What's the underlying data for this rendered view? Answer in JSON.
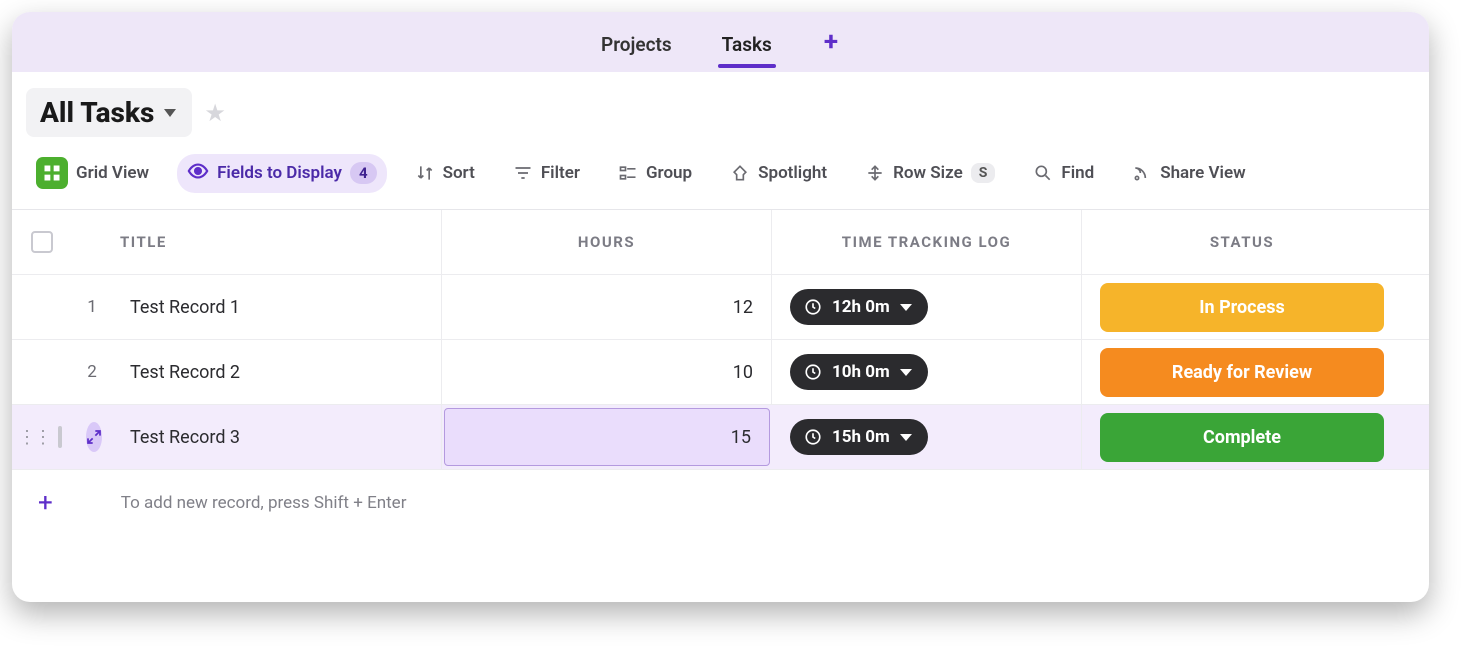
{
  "tabs": {
    "items": [
      {
        "label": "Projects",
        "active": false
      },
      {
        "label": "Tasks",
        "active": true
      }
    ]
  },
  "view": {
    "title": "All Tasks"
  },
  "toolbar": {
    "grid_view": "Grid View",
    "fields": "Fields to Display",
    "fields_count": "4",
    "sort": "Sort",
    "filter": "Filter",
    "group": "Group",
    "spotlight": "Spotlight",
    "rowsize": "Row Size",
    "rowsize_code": "S",
    "find": "Find",
    "share": "Share View"
  },
  "grid": {
    "headers": {
      "title": "TITLE",
      "hours": "HOURS",
      "log": "TIME TRACKING LOG",
      "status": "STATUS"
    },
    "rows": [
      {
        "n": "1",
        "title": "Test Record 1",
        "hours": "12",
        "log": "12h 0m",
        "status": "In Process",
        "status_class": "status-inprocess",
        "active": false
      },
      {
        "n": "2",
        "title": "Test Record 2",
        "hours": "10",
        "log": "10h 0m",
        "status": "Ready for Review",
        "status_class": "status-review",
        "active": false
      },
      {
        "n": "3",
        "title": "Test Record 3",
        "hours": "15",
        "log": "15h 0m",
        "status": "Complete",
        "status_class": "status-complete",
        "active": true
      }
    ],
    "footer_hint": "To add new record, press Shift + Enter"
  }
}
